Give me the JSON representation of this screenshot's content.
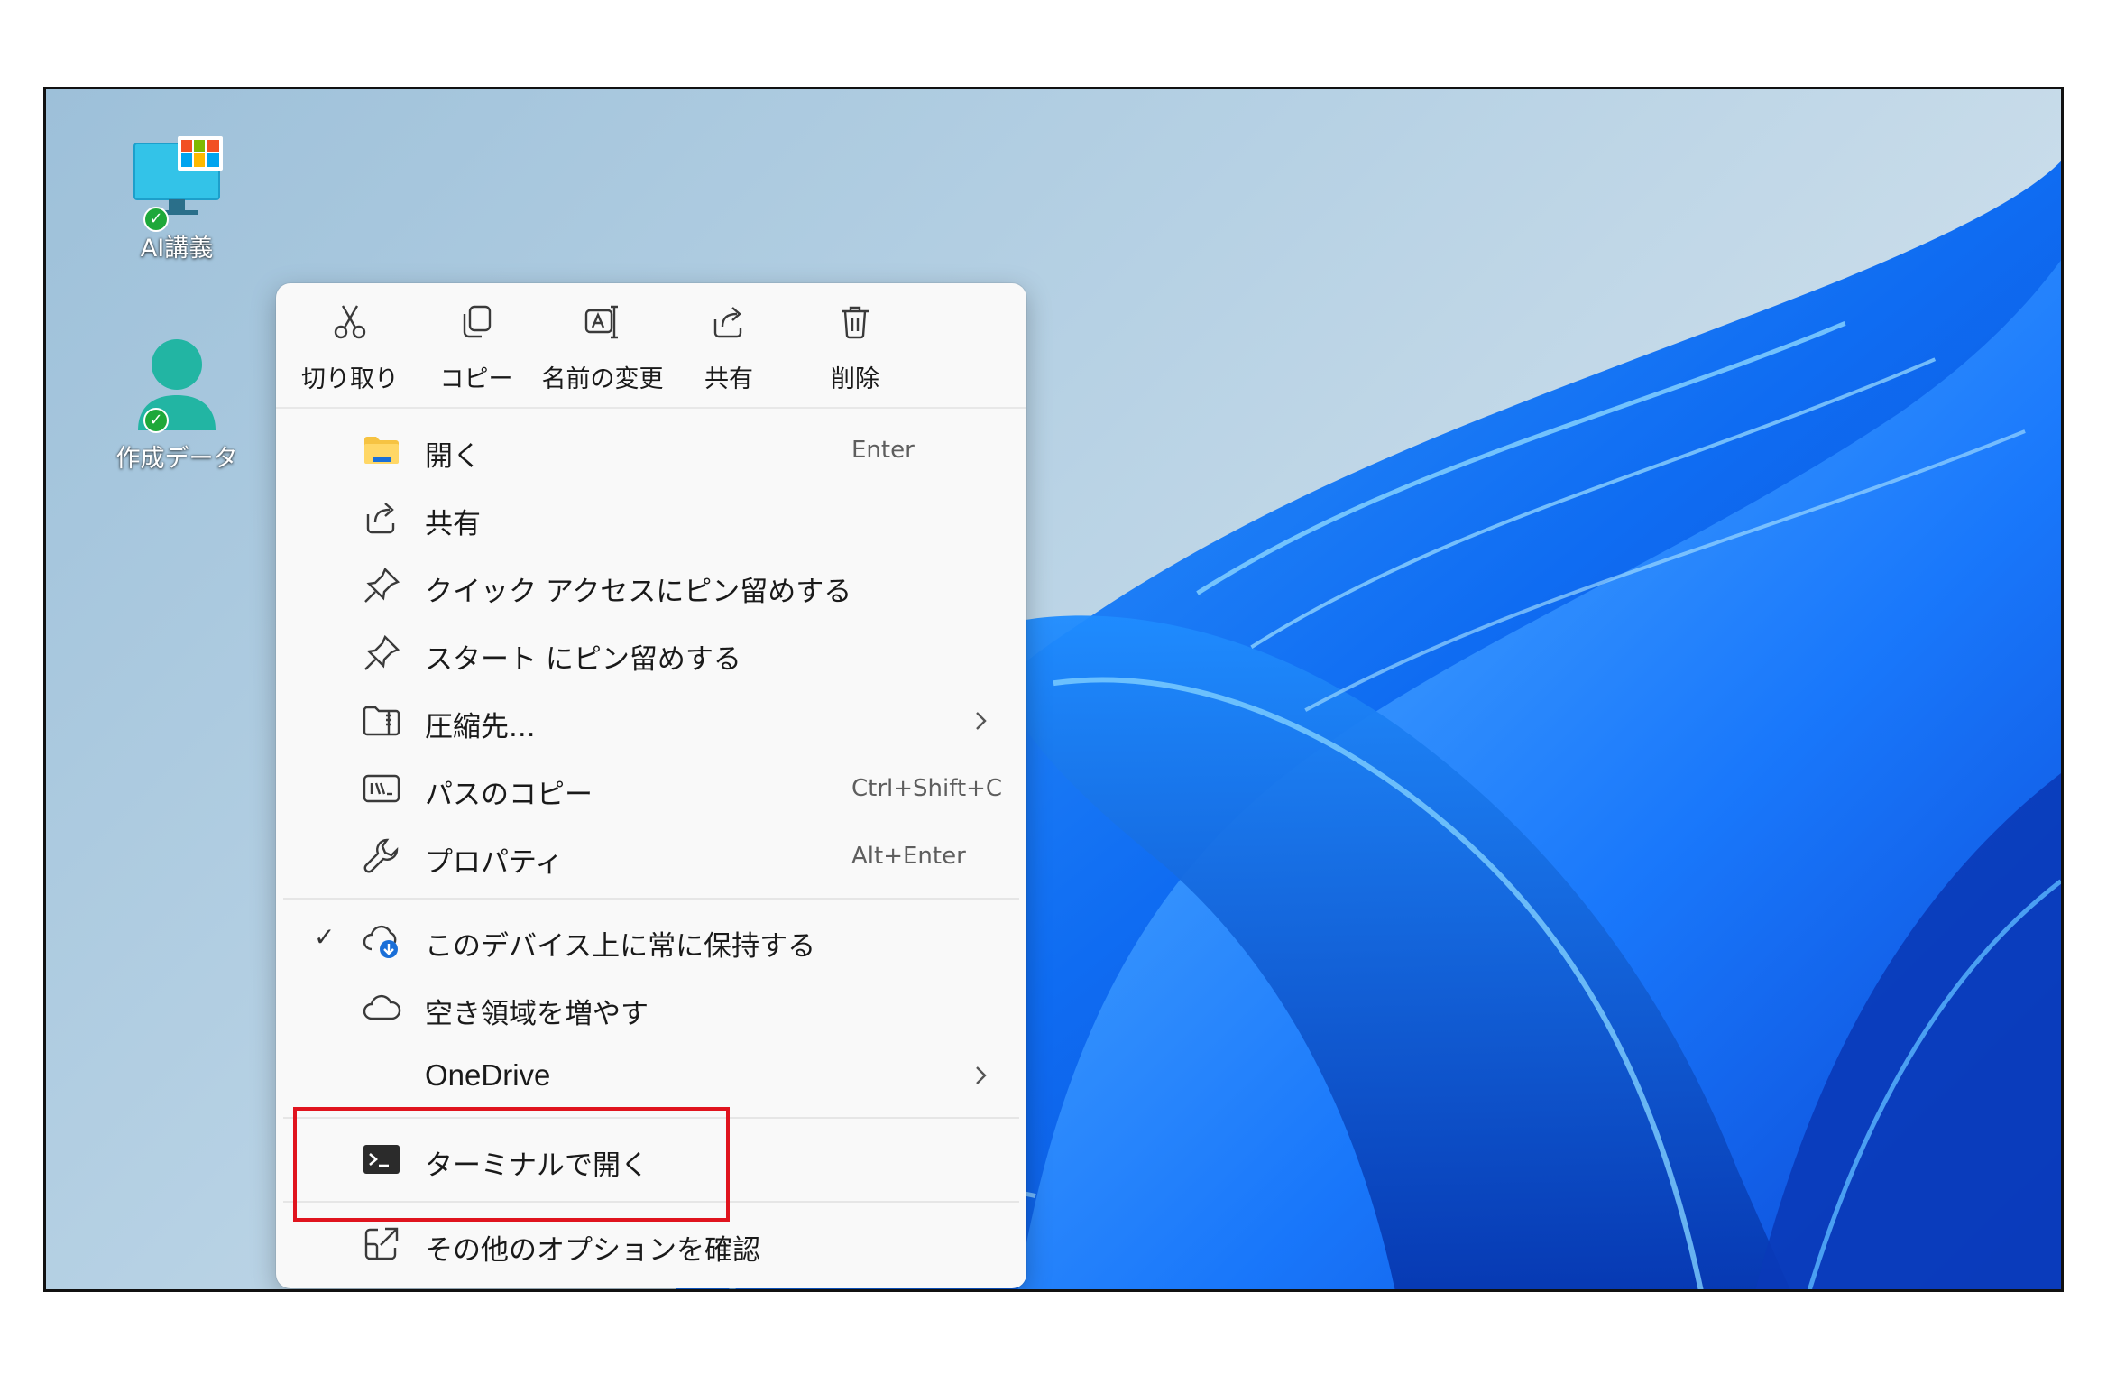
{
  "desktop": {
    "icons": [
      {
        "label": "AI講義",
        "icon": "computer-app-icon",
        "status": "synced"
      },
      {
        "label": "作成データ",
        "icon": "user-folder-icon",
        "status": "synced"
      }
    ]
  },
  "context_menu": {
    "toolbar": [
      {
        "label": "切り取り",
        "icon": "scissors-icon"
      },
      {
        "label": "コピー",
        "icon": "copy-icon"
      },
      {
        "label": "名前の変更",
        "icon": "rename-icon"
      },
      {
        "label": "共有",
        "icon": "share-icon"
      },
      {
        "label": "削除",
        "icon": "trash-icon"
      }
    ],
    "items": [
      {
        "label": "開く",
        "shortcut": "Enter",
        "icon": "folder-icon"
      },
      {
        "label": "共有",
        "shortcut": "",
        "icon": "share-icon"
      },
      {
        "label": "クイック アクセスにピン留めする",
        "shortcut": "",
        "icon": "pin-icon"
      },
      {
        "label": "スタート にピン留めする",
        "shortcut": "",
        "icon": "pin-icon"
      },
      {
        "label": "圧縮先...",
        "shortcut": "",
        "icon": "zip-folder-icon",
        "submenu": true
      },
      {
        "label": "パスのコピー",
        "shortcut": "Ctrl+Shift+C",
        "icon": "path-icon"
      },
      {
        "label": "プロパティ",
        "shortcut": "Alt+Enter",
        "icon": "wrench-icon"
      },
      {
        "label": "このデバイス上に常に保持する",
        "shortcut": "",
        "icon": "cloud-download-icon",
        "checked": true
      },
      {
        "label": "空き領域を増やす",
        "shortcut": "",
        "icon": "cloud-icon"
      },
      {
        "label": "OneDrive",
        "shortcut": "",
        "icon": "",
        "submenu": true
      },
      {
        "label": "ターミナルで開く",
        "shortcut": "",
        "icon": "terminal-icon"
      },
      {
        "label": "その他のオプションを確認",
        "shortcut": "",
        "icon": "external-icon"
      }
    ],
    "check_mark": "✓"
  },
  "annotation": {
    "highlight_color": "#e0141e",
    "highlight_target": "その他のオプションを確認"
  }
}
